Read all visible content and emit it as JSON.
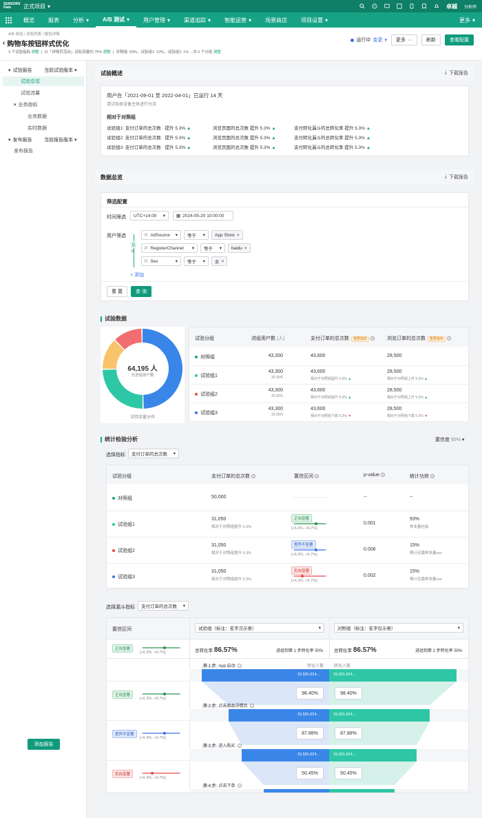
{
  "topbar": {
    "logo": "SENSORS Data",
    "project": "正式项目",
    "user": "卓越",
    "role": "分析师"
  },
  "nav": {
    "items": [
      "概览",
      "报表",
      "分析",
      "A/B 测试",
      "用户管理",
      "渠道追踪",
      "智能运营",
      "场景商店",
      "项目设置"
    ],
    "active": 3,
    "more": "更多"
  },
  "header": {
    "breadcrumb": "A/B 测试 / 试验列表 / 报告详情",
    "title": "购物车按钮样式优化",
    "meta1": "3 个试验指标",
    "meta1_link": "调整",
    "meta2": "占「详情页活动」试验流量约 70%",
    "meta2_link": "调整",
    "meta3": "对照组: 50%，试验组1: 10%，试验组2: 1% ...共 5 个分组",
    "meta3_link": "调整",
    "status": "运行中",
    "status_change": "变更",
    "btn_more": "更多",
    "btn_refresh": "刷新",
    "btn_config": "查看配置"
  },
  "sidebar": {
    "report": "试验报告",
    "report_version": "当前试验版本",
    "items": [
      "试验总览",
      "试验流量",
      "业务指标",
      "业务数据",
      "实时数据"
    ],
    "publish": "发布报告",
    "publish_version": "当前报告版本",
    "publish_item": "发布报告",
    "add_report": "添加报告"
  },
  "overview": {
    "title": "试验概述",
    "download": "下载报告",
    "summary": "用户在「2021-09-01 至 2022-04-01」已运行 14 天",
    "sub": "请试验按设备主体进行分流",
    "compare_title": "相对于对照组",
    "rows": [
      {
        "group": "试验组1:",
        "c1": "支付订单的总次数",
        "v1": "提升 5.3%",
        "c2": "浏览页面的总次数",
        "v2": "提升 5.3%",
        "c3": "支付转化漏斗的总转化率",
        "v3": "提升 5.3%"
      },
      {
        "group": "试验组2:",
        "c1": "支付订单的总次数",
        "v1": "提升 5.3%",
        "c2": "浏览页面的总次数",
        "v2": "提升 5.3%",
        "c3": "支付转化漏斗的总转化率",
        "v3": "提升 5.3%"
      },
      {
        "group": "试验组3:",
        "c1": "支付订单的总次数",
        "v1": "提升 5.3%",
        "c2": "浏览页面的总次数",
        "v2": "提升 5.3%",
        "c3": "支付转化漏斗的总转化率",
        "v3": "提升 5.3%"
      }
    ]
  },
  "datasummary": {
    "title": "数据总览",
    "download": "下载报告",
    "filter_title": "筛选配置",
    "time_label": "时间筛选",
    "timezone": "UTC+14:00",
    "date": "2024-05-20 10:00:00",
    "user_label": "用户筛选",
    "and": "且",
    "or": "或",
    "filters": [
      {
        "field": "AdSource",
        "op": "等于",
        "value": "App Store"
      },
      {
        "field": "RegisterChannel",
        "op": "等于",
        "value": "baidu"
      },
      {
        "field": "Sex",
        "op": "等于",
        "value": "女"
      }
    ],
    "add": "添加",
    "reset": "重 置",
    "query": "查 询"
  },
  "expdata": {
    "title": "试验数据",
    "donut_total": "64,195 人",
    "donut_label": "总进组用户数",
    "donut_caption": "试验流量分布",
    "headers": [
      "试验分组",
      "进组用户数",
      "支付订单的总次数",
      "浏览订单的总次数"
    ],
    "units": "(人)",
    "badge": "重要指标",
    "rows": [
      {
        "name": "对照组",
        "color": "#16a385",
        "users": "43,300",
        "pct": "",
        "m1": "43,600",
        "m1_sub": "",
        "m2": "28,500",
        "m2_sub": ""
      },
      {
        "name": "试验组1",
        "color": "#2ec7a5",
        "users": "43,300",
        "pct": "32.00%",
        "m1": "43,600",
        "m1_sub": "相对于对照组提升 5.3%",
        "m2": "28,500",
        "m2_sub": "相对于对照组上升 5.3%"
      },
      {
        "name": "试验组2",
        "color": "#e24b4b",
        "users": "43,300",
        "pct": "32.00%",
        "m1": "43,600",
        "m1_sub": "相对于对照组提升 5.3%",
        "m2": "28,500",
        "m2_sub": "相对于对照组上升 5.3%"
      },
      {
        "name": "试验组3",
        "color": "#3a6fe8",
        "users": "43,300",
        "pct": "32.00%",
        "m1": "43,600",
        "m1_sub": "相对于对照组下跌 5.3%",
        "m2": "28,500",
        "m2_sub": "相对于对照组下跌 5.3%"
      }
    ]
  },
  "stats": {
    "title": "统计检验分析",
    "conf_label": "置信度",
    "conf_value": "95%",
    "select_label": "选择指标",
    "select_value": "支付订单的总次数",
    "headers": [
      "试验分组",
      "支付订单的总次数",
      "置信区间",
      "p-value",
      "统计功效"
    ],
    "rows": [
      {
        "name": "对照组",
        "color": "#16a385",
        "val": "50,000",
        "sub": "",
        "tag": "",
        "tagtype": "",
        "ci": "",
        "p": "--",
        "power": "--",
        "power_sub": ""
      },
      {
        "name": "试验组1",
        "color": "#2ec7a5",
        "val": "31,050",
        "sub": "相对于对照组提升 5.3%",
        "tag": "正向显著",
        "tagtype": "good",
        "ci": "[+6.3%, +9.7%]",
        "p": "0.001",
        "power": "93%",
        "power_sub": "样本量达标"
      },
      {
        "name": "试验组2",
        "color": "#e24b4b",
        "val": "31,050",
        "sub": "相对于对照组提升 5.3%",
        "tag": "差异不显著",
        "tagtype": "neutral",
        "ci": "[+6.3%, +9.7%]",
        "p": "0.006",
        "power": "15%",
        "power_sub": "预计还需样本量xxx"
      },
      {
        "name": "试验组3",
        "color": "#3a6fe8",
        "val": "31,050",
        "sub": "相对于对照组提升 5.3%",
        "tag": "负向显著",
        "tagtype": "bad",
        "ci": "[+6.3%, +9.7%]",
        "p": "0.002",
        "power": "15%",
        "power_sub": "预计还需样本量xxx"
      }
    ]
  },
  "funnel": {
    "select_label": "选择漏斗指标",
    "select_value": "支付订单的总次数",
    "ci_header": "置信区间",
    "left_select": "试验组（标注：名字汉示意）",
    "right_select": "对照组（标注：名字仅示意）",
    "total_label": "总转化率",
    "total_left": "86.57%",
    "total_right": "86.57%",
    "step_rate_label": "进组到第 1 步转化率",
    "step_rate_value": "50%",
    "ci_rows": [
      {
        "tag": "正向显著",
        "tagtype": "good",
        "ci": "[+6.3%, +9.7%]"
      },
      {
        "tag": "正向显著",
        "tagtype": "good",
        "ci": "[+6.3%, +9.7%]"
      },
      {
        "tag": "差异不显著",
        "tagtype": "neutral",
        "ci": "[+6.3%, +9.7%]"
      },
      {
        "tag": "负向显著",
        "tagtype": "bad",
        "ci": "[+6.3%, +9.7%]"
      }
    ],
    "steps": [
      {
        "label": "第 1 步",
        "name": "App 启动",
        "left": "15,581,624...",
        "right": "15,581,624...",
        "rate_l": "98.40%",
        "rate_r": "98.40%"
      },
      {
        "label": "第 2 步",
        "name": "点击商品详情页",
        "left": "15,581,624...",
        "right": "15,581,624...",
        "rate_l": "87.88%",
        "rate_r": "87.88%"
      },
      {
        "label": "第 3 步",
        "name": "进入购买",
        "left": "15,581,624...",
        "right": "15,581,624...",
        "rate_l": "50.45%",
        "rate_r": "50.45%"
      },
      {
        "label": "第 4 步",
        "name": "点击下单",
        "left": "",
        "right": "",
        "rate_l": "",
        "rate_r": ""
      }
    ],
    "conv_label": "转化人数",
    "conv_label2": "转化人数"
  }
}
